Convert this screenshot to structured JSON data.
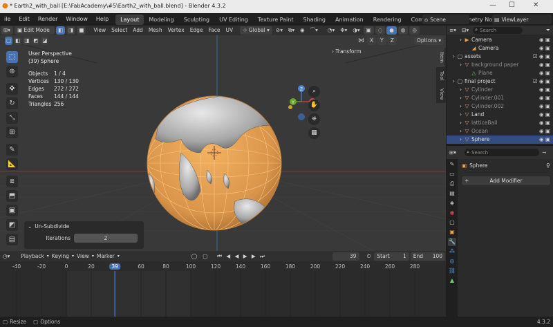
{
  "titlebar": {
    "title": "* Earth2_with_ball [E:\\FabAcademy\\#5\\Earth2_with_ball.blend] - Blender 4.3.2",
    "minimize": "—",
    "maximize": "☐",
    "close": "✕"
  },
  "menubar": {
    "menus": [
      "ile",
      "Edit",
      "Render",
      "Window",
      "Help"
    ],
    "workspaces": [
      "Layout",
      "Modeling",
      "Sculpting",
      "UV Editing",
      "Texture Paint",
      "Shading",
      "Animation",
      "Rendering",
      "Compositing",
      "Geometry Node"
    ],
    "active_workspace": "Layout",
    "scene": "Scene",
    "view_layer": "ViewLayer"
  },
  "viewport_header": {
    "mode": "Edit Mode",
    "menus": [
      "View",
      "Select",
      "Add",
      "Mesh",
      "Vertex",
      "Edge",
      "Face",
      "UV"
    ],
    "orientation": "Global",
    "options": "Options",
    "axes": [
      "X",
      "Y",
      "Z"
    ]
  },
  "overlay": {
    "view_name": "User Perspective",
    "object_name": "(39) Sphere",
    "stats": [
      {
        "label": "Objects",
        "value": "1 / 4"
      },
      {
        "label": "Vertices",
        "value": "130 / 130"
      },
      {
        "label": "Edges",
        "value": "272 / 272"
      },
      {
        "label": "Faces",
        "value": "144 / 144"
      },
      {
        "label": "Triangles",
        "value": "256"
      }
    ],
    "transform_panel": "Transform",
    "side_tabs": [
      "Item",
      "Tool",
      "View"
    ]
  },
  "operator_panel": {
    "title": "Un-Subdivide",
    "field_label": "Iterations",
    "field_value": "2"
  },
  "timeline": {
    "menus": [
      "Playback",
      "Keying",
      "View",
      "Marker"
    ],
    "current_frame": "39",
    "start_label": "Start",
    "start_value": "1",
    "end_label": "End",
    "end_value": "100",
    "ticks": [
      "-40",
      "-20",
      "0",
      "20",
      "39",
      "60",
      "80",
      "100",
      "120",
      "140",
      "160",
      "180",
      "200",
      "220",
      "240",
      "260",
      "280"
    ]
  },
  "status": {
    "left_a": "Resize",
    "left_b": "Options",
    "version": "4.3.2"
  },
  "outliner": {
    "search_placeholder": "Search",
    "rows": [
      {
        "name": "Camera",
        "indent": 1,
        "icon": "camera-icon",
        "dim": false,
        "selected": false
      },
      {
        "name": "Camera",
        "indent": 2,
        "icon": "camera-data-icon",
        "dim": false,
        "selected": false
      },
      {
        "name": "assets",
        "indent": 0,
        "icon": "collection-icon",
        "dim": false,
        "selected": false
      },
      {
        "name": "background paper",
        "indent": 1,
        "icon": "mesh-icon",
        "dim": true,
        "selected": false
      },
      {
        "name": "Plane",
        "indent": 2,
        "icon": "mesh-data-icon",
        "dim": true,
        "selected": false
      },
      {
        "name": "final project",
        "indent": 0,
        "icon": "collection-icon",
        "dim": false,
        "selected": false
      },
      {
        "name": "Cylinder",
        "indent": 1,
        "icon": "mesh-icon",
        "dim": true,
        "selected": false
      },
      {
        "name": "Cylinder.001",
        "indent": 1,
        "icon": "mesh-icon",
        "dim": true,
        "selected": false
      },
      {
        "name": "Cylinder.002",
        "indent": 1,
        "icon": "mesh-icon",
        "dim": true,
        "selected": false
      },
      {
        "name": "Land",
        "indent": 1,
        "icon": "mesh-icon",
        "dim": false,
        "selected": false
      },
      {
        "name": "latticeBall",
        "indent": 1,
        "icon": "mesh-icon",
        "dim": true,
        "selected": false
      },
      {
        "name": "Ocean",
        "indent": 1,
        "icon": "mesh-icon",
        "dim": true,
        "selected": false
      },
      {
        "name": "Sphere",
        "indent": 1,
        "icon": "mesh-icon",
        "dim": false,
        "selected": true
      }
    ]
  },
  "properties": {
    "search_placeholder": "Search",
    "object_name": "Sphere",
    "add_modifier": "Add Modifier"
  },
  "colors": {
    "accent": "#4772b3",
    "selection_orange": "#e8a04a",
    "globe_gray": "#b8b8b8"
  }
}
